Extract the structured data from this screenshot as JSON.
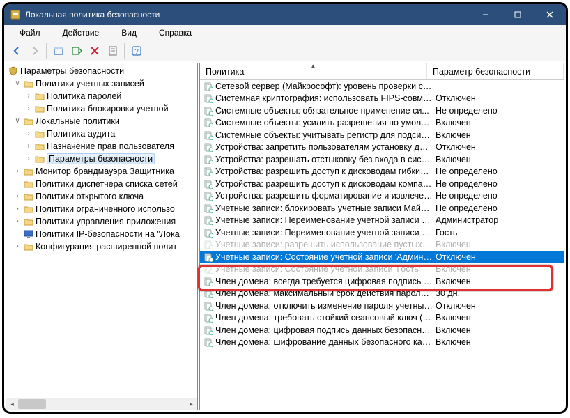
{
  "window": {
    "title": "Локальная политика безопасности"
  },
  "menu": {
    "file": "Файл",
    "action": "Действие",
    "view": "Вид",
    "help": "Справка"
  },
  "tree": {
    "root": "Параметры безопасности",
    "n1": "Политики учетных записей",
    "n1a": "Политика паролей",
    "n1b": "Политика блокировки учетной",
    "n2": "Локальные политики",
    "n2a": "Политика аудита",
    "n2b": "Назначение прав пользователя",
    "n2c": "Параметры безопасности",
    "n3": "Монитор брандмауэра Защитника ",
    "n4": "Политики диспетчера списка сетей",
    "n5": "Политики открытого ключа",
    "n6": "Политики ограниченного использо",
    "n7": "Политики управления приложения",
    "n8": "Политики IP-безопасности на \"Лока",
    "n9": "Конфигурация расширенной полит"
  },
  "list": {
    "col1": "Политика",
    "col2": "Параметр безопасности",
    "rows": [
      {
        "p": "Сетевой сервер (Майкрософт): уровень проверки сервер...",
        "v": ""
      },
      {
        "p": "Системная криптография: использовать FIPS-совместим...",
        "v": "Отключен"
      },
      {
        "p": "Системные объекты: обязательное применение си...",
        "v": "Не определено"
      },
      {
        "p": "Системные объекты: усилить разрешения по умолчани...",
        "v": "Включен"
      },
      {
        "p": "Системные объекты: учитывать регистр для подсистем, ...",
        "v": "Включен"
      },
      {
        "p": "Устройства: запретить пользователям установку драйвер...",
        "v": "Отключен"
      },
      {
        "p": "Устройства: разрешать отстыковку без входа в систему",
        "v": "Включен"
      },
      {
        "p": "Устройства: разрешить доступ к дисководам гибких диск...",
        "v": "Не определено"
      },
      {
        "p": "Устройства: разрешить доступ к дисководам компакт-д...",
        "v": "Не определено"
      },
      {
        "p": "Устройства: разрешить форматирование и извлечение с...",
        "v": "Не определено"
      },
      {
        "p": "Учетные записи: блокировать учетные записи Майкросо...",
        "v": "Не определено"
      },
      {
        "p": "Учетные записи: Переименование учетной записи админ...",
        "v": "Администратор"
      },
      {
        "p": "Учетные записи: Переименование учетной записи гостя",
        "v": "Гость"
      },
      {
        "p": "Учетные записи: разрешить использование пустых паро...",
        "v": "Включен",
        "obscured": true
      },
      {
        "p": "Учетные записи: Состояние учетной записи 'Администра...",
        "v": "Отключен",
        "sel": true
      },
      {
        "p": "Учетные записи: Состояние учетной записи 'Гость'",
        "v": "Включен",
        "obscured": true
      },
      {
        "p": "Член домена: всегда требуется цифровая подпись или ш...",
        "v": "Включен"
      },
      {
        "p": "Член домена: максимальный срок действия пароля учет...",
        "v": "30 дн."
      },
      {
        "p": "Член домена: отключить изменение пароля учетных зап...",
        "v": "Отключен"
      },
      {
        "p": "Член домена: требовать стойкий сеансовый ключ (Wind...",
        "v": "Включен"
      },
      {
        "p": "Член домена: цифровая подпись данных безопасного ка...",
        "v": "Включен"
      },
      {
        "p": "Член домена: шифрование данных безопасного канала, ...",
        "v": "Включен"
      }
    ]
  }
}
